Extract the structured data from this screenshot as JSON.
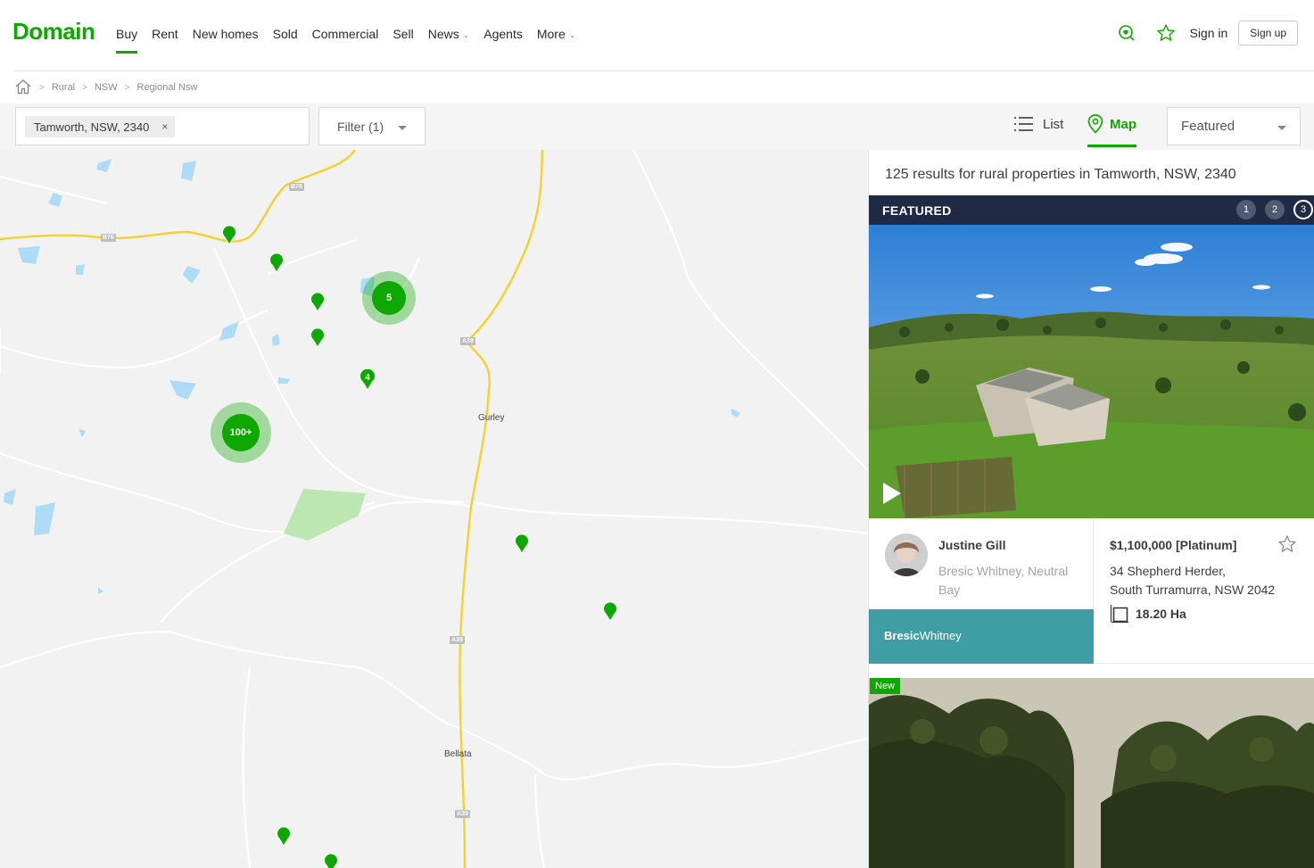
{
  "header": {
    "logo": "Domain",
    "nav": [
      {
        "label": "Buy",
        "active": true
      },
      {
        "label": "Rent"
      },
      {
        "label": "New homes"
      },
      {
        "label": "Sold"
      },
      {
        "label": "Commercial"
      },
      {
        "label": "Sell"
      },
      {
        "label": "News",
        "dropdown": true
      },
      {
        "label": "Agents"
      },
      {
        "label": "More",
        "dropdown": true
      }
    ],
    "sign_in": "Sign in",
    "sign_up": "Sign up",
    "accent": "#0ea800"
  },
  "breadcrumb": [
    "Rural",
    "NSW",
    "Regional Nsw"
  ],
  "toolbar": {
    "search_chip": "Tamworth, NSW, 2340",
    "filter_label": "Filter (1)",
    "list_label": "List",
    "map_label": "Map",
    "sort_value": "Featured"
  },
  "map": {
    "towns": [
      "Gurley",
      "Bellata"
    ],
    "roads": [
      "B76",
      "B76",
      "A39",
      "A39",
      "A39"
    ],
    "clusters": [
      "5",
      "100+"
    ],
    "pin_count_label": "4"
  },
  "results": {
    "count_text": "125 results for rural properties in Tamworth, NSW, 2340",
    "featured_label": "FEATURED",
    "pages": [
      "1",
      "2",
      "3"
    ],
    "featured_listing": {
      "agent_name": "Justine Gill",
      "agent_office": "Bresic Whitney, Neutral Bay",
      "agency_bold": "Bresic",
      "agency_light": "Whitney",
      "agency_color": "#3e9ea4",
      "price": "$1,100,000 [Platinum]",
      "address_line1": "34 Shepherd Herder,",
      "address_line2": "South Turramurra, NSW 2042",
      "land_size": "18.20 Ha"
    },
    "next_badge": "New"
  }
}
